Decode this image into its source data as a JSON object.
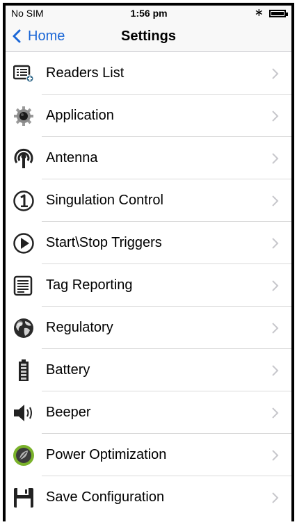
{
  "status_bar": {
    "carrier": "No SIM",
    "time": "1:56 pm",
    "bluetooth_icon": "bluetooth-icon",
    "battery_icon": "battery-icon"
  },
  "nav": {
    "back_label": "Home",
    "title": "Settings"
  },
  "colors": {
    "accent": "#1a66d6",
    "separator": "#d9d9d9",
    "chevron": "#c7c7cc"
  },
  "settings": [
    {
      "label": "Readers List",
      "icon": "readers-list-icon"
    },
    {
      "label": "Application",
      "icon": "gear-icon"
    },
    {
      "label": "Antenna",
      "icon": "antenna-icon"
    },
    {
      "label": "Singulation Control",
      "icon": "number-one-icon"
    },
    {
      "label": "Start\\Stop Triggers",
      "icon": "play-icon"
    },
    {
      "label": "Tag Reporting",
      "icon": "document-icon"
    },
    {
      "label": "Regulatory",
      "icon": "globe-icon"
    },
    {
      "label": "Battery",
      "icon": "battery-level-icon"
    },
    {
      "label": "Beeper",
      "icon": "speaker-icon"
    },
    {
      "label": "Power Optimization",
      "icon": "power-optimization-icon"
    },
    {
      "label": "Save Configuration",
      "icon": "save-icon"
    }
  ]
}
